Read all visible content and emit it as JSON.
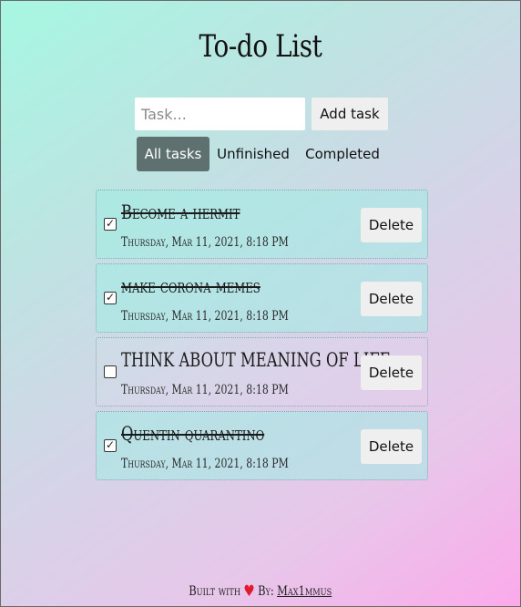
{
  "app": {
    "title": "To-do List"
  },
  "input": {
    "placeholder": "Task...",
    "value": ""
  },
  "add_button": {
    "label": "Add task"
  },
  "filters": [
    {
      "label": "All tasks",
      "active": true
    },
    {
      "label": "Unfinished",
      "active": false
    },
    {
      "label": "Completed",
      "active": false
    }
  ],
  "tasks": [
    {
      "name": "Become a hermit",
      "date": "Thursday, Mar 11, 2021, 8:18 PM",
      "checked": true,
      "checkmark": "✓",
      "delete_label": "Delete"
    },
    {
      "name": "make corona memes",
      "date": "Thursday, Mar 11, 2021, 8:18 PM",
      "checked": true,
      "checkmark": "✓",
      "delete_label": "Delete"
    },
    {
      "name": "THINK ABOUT MEANING OF LIFE",
      "date": "Thursday, Mar 11, 2021, 8:18 PM",
      "checked": false,
      "checkmark": "",
      "delete_label": "Delete"
    },
    {
      "name": "Quentin quarantino",
      "date": "Thursday, Mar 11, 2021, 8:18 PM",
      "checked": true,
      "checkmark": "✓",
      "delete_label": "Delete"
    }
  ],
  "footer": {
    "built_with": "Built with",
    "heart": "♥",
    "by": "By:",
    "author": "Max1mmus"
  },
  "colors": {
    "active_filter": "#5e7170",
    "heart": "#e01b2e",
    "gradient_start": "#a6f7e2",
    "gradient_end": "#fbaaea"
  }
}
